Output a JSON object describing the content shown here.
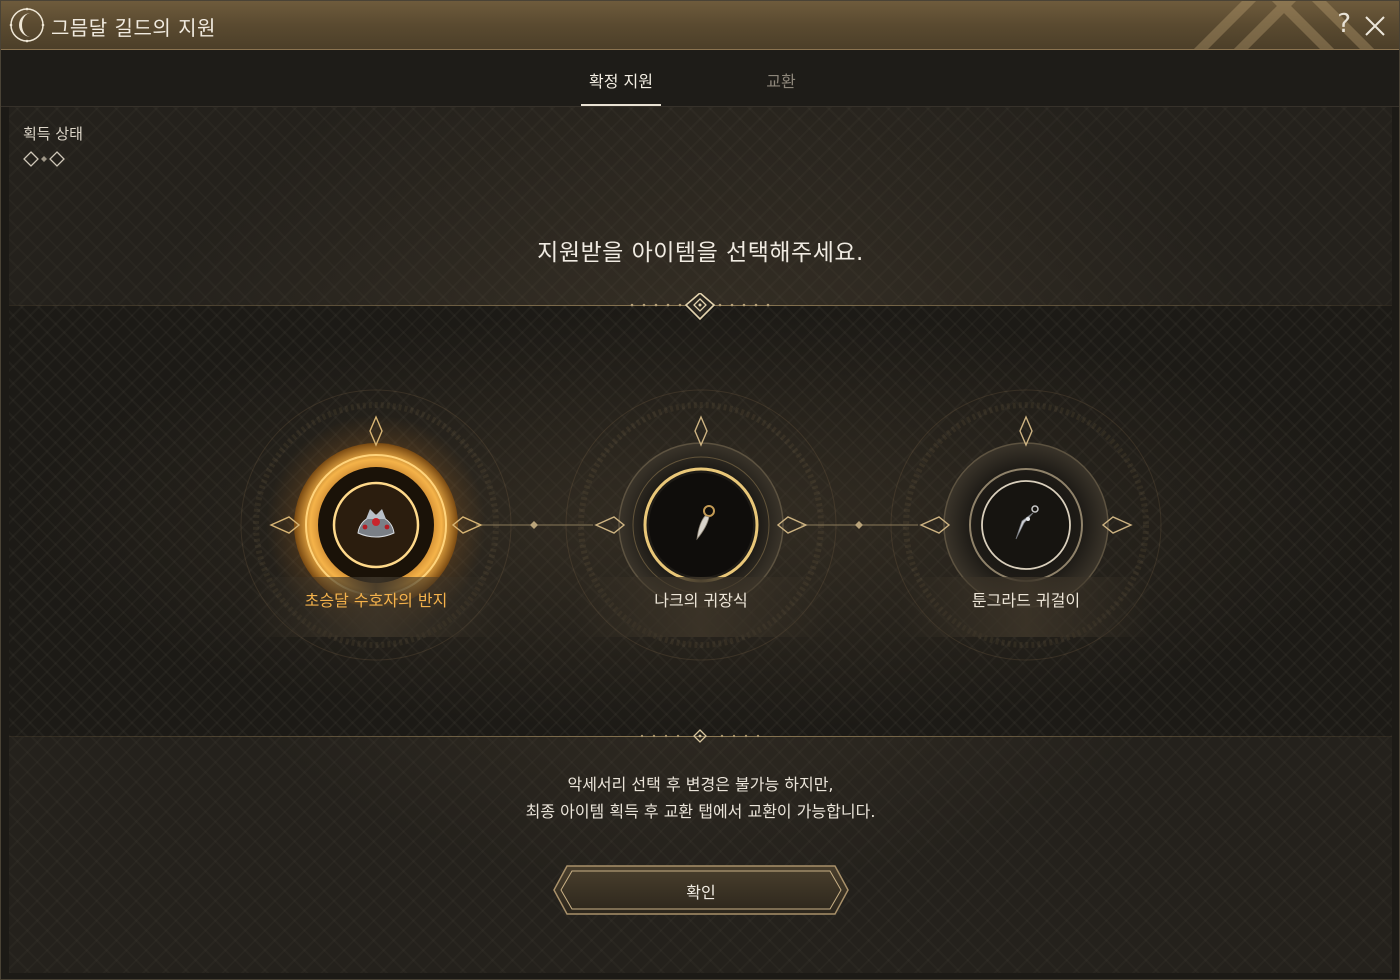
{
  "window": {
    "title": "그믐달 길드의 지원"
  },
  "tabs": [
    {
      "label": "확정 지원",
      "active": true
    },
    {
      "label": "교환",
      "active": false
    }
  ],
  "status": {
    "label": "획득 상태",
    "progress_filled": 0,
    "progress_total": 2
  },
  "prompt": "지원받을 아이템을 선택해주세요.",
  "items": [
    {
      "name": "초승달 수호자의 반지",
      "icon": "ring-icon",
      "selected": true
    },
    {
      "name": "나크의 귀장식",
      "icon": "ear-ornament-icon",
      "selected": false
    },
    {
      "name": "툰그라드 귀걸이",
      "icon": "earring-icon",
      "selected": false
    }
  ],
  "notice": {
    "line1": "악세서리 선택 후 변경은 불가능 하지만,",
    "line2": "최종 아이템 획득 후 교환 탭에서 교환이 가능합니다."
  },
  "confirm_label": "확인",
  "colors": {
    "accent_gold": "#f0b54a",
    "text": "#ebe5da",
    "frame": "#6e5b3c"
  }
}
